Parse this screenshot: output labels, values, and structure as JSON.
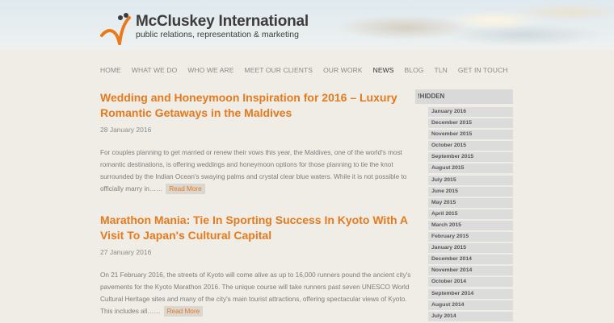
{
  "brand": {
    "name": "McCluskey International",
    "tagline": "public relations, representation & marketing",
    "logo_icon": "stylized-figure-icon",
    "accent_color": "#e8791c"
  },
  "nav": {
    "items": [
      "HOME",
      "WHAT WE DO",
      "WHO WE ARE",
      "MEET OUR CLIENTS",
      "OUR WORK",
      "NEWS",
      "BLOG",
      "TLN",
      "GET IN TOUCH"
    ],
    "active": "NEWS"
  },
  "posts": [
    {
      "title": "Wedding and Honeymoon Inspiration for 2016 – Luxury Romantic Getaways in the Maldives",
      "date": "28 January 2016",
      "excerpt": "For couples planning to get married or renew their vows this year, the Maldives, one of the world's most romantic destinations, is offering weddings and honeymoon options for those planning to tie the knot surrounded by the Indian Ocean's swaying palms and crystal clear blue waters. While it is not possible to officially marry in……",
      "read_more": "Read More"
    },
    {
      "title": "Marathon Mania: Tie In Sporting Success In Kyoto With A Visit To Japan's Cultural Capital",
      "date": "27 January 2016",
      "excerpt": "On 21 February 2016, the streets of Kyoto will come alive as up to 16,000 runners pound the ancient city's pavements for the Kyoto Marathon 2016. The unique course will take runners past seven UNESCO World Cultural Heritage sites and many of the city's main tourist attractions, offering spectacular views of Kyoto. This includes all……",
      "read_more": "Read More"
    }
  ],
  "sidebar": {
    "heading": "!HIDDEN",
    "archive": [
      "January 2016",
      "December 2015",
      "November 2015",
      "October 2015",
      "September 2015",
      "August 2015",
      "July 2015",
      "June 2015",
      "May 2015",
      "April 2015",
      "March 2015",
      "February 2015",
      "January 2015",
      "December 2014",
      "November 2014",
      "October 2014",
      "September 2014",
      "August 2014",
      "July 2014"
    ]
  }
}
